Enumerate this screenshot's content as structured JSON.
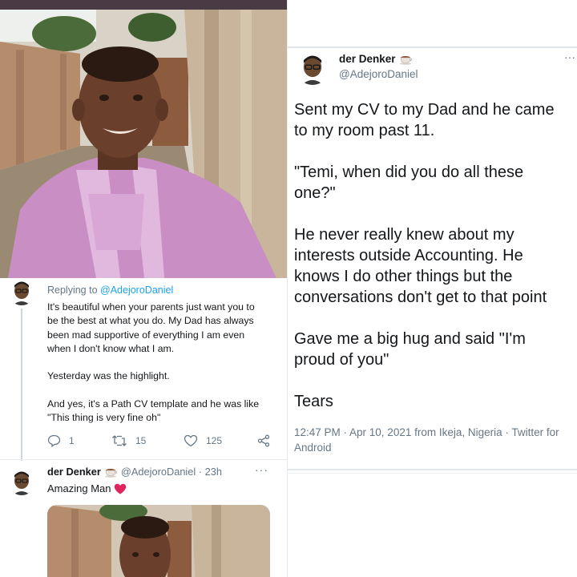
{
  "left": {
    "reply": {
      "replying_prefix": "Replying to ",
      "replying_handle": "@AdejoroDaniel",
      "lines": [
        "It's beautiful when your parents just want you to",
        "be the best at what you do. My Dad has always",
        "been mad supportive of everything I am even",
        "when I don't know what I am.",
        "",
        "Yesterday was the highlight.",
        "",
        "And yes, it's a Path CV template and he was like",
        "\"This thing is very fine oh\""
      ],
      "actions": {
        "replies": "1",
        "retweets": "15",
        "likes": "125"
      }
    },
    "tweet2": {
      "name": "der Denker",
      "handle_time": "@AdejoroDaniel · 23h",
      "more": "···",
      "text": "Amazing Man"
    }
  },
  "right": {
    "name": "der Denker",
    "handle": "@AdejoroDaniel",
    "more": "···",
    "body": [
      "Sent my CV to my Dad and he came",
      "to my room past 11.",
      "",
      "\"Temi, when did you do all these",
      "one?\"",
      "",
      "He never really knew about my",
      "interests outside Accounting. He",
      "knows I do other things but the",
      "conversations don't get to that point",
      "",
      "Gave me a big hug and said \"I'm",
      "proud of you\"",
      "",
      "Tears"
    ],
    "meta_time": "12:47 PM · Apr 10, 2021 from Ikeja, Nigeria · Twitter for",
    "meta_client": "Android"
  },
  "colors": {
    "text": "#14171a",
    "secondary": "#657786",
    "link": "#1da1f2",
    "heart": "#e0245e",
    "shirt": "#c98fc4"
  },
  "icons": {
    "reply": "reply-icon",
    "retweet": "retweet-icon",
    "like": "heart-icon",
    "share": "share-icon",
    "teacup": "teacup-emoji-icon",
    "red_heart": "red-heart-emoji-icon"
  }
}
